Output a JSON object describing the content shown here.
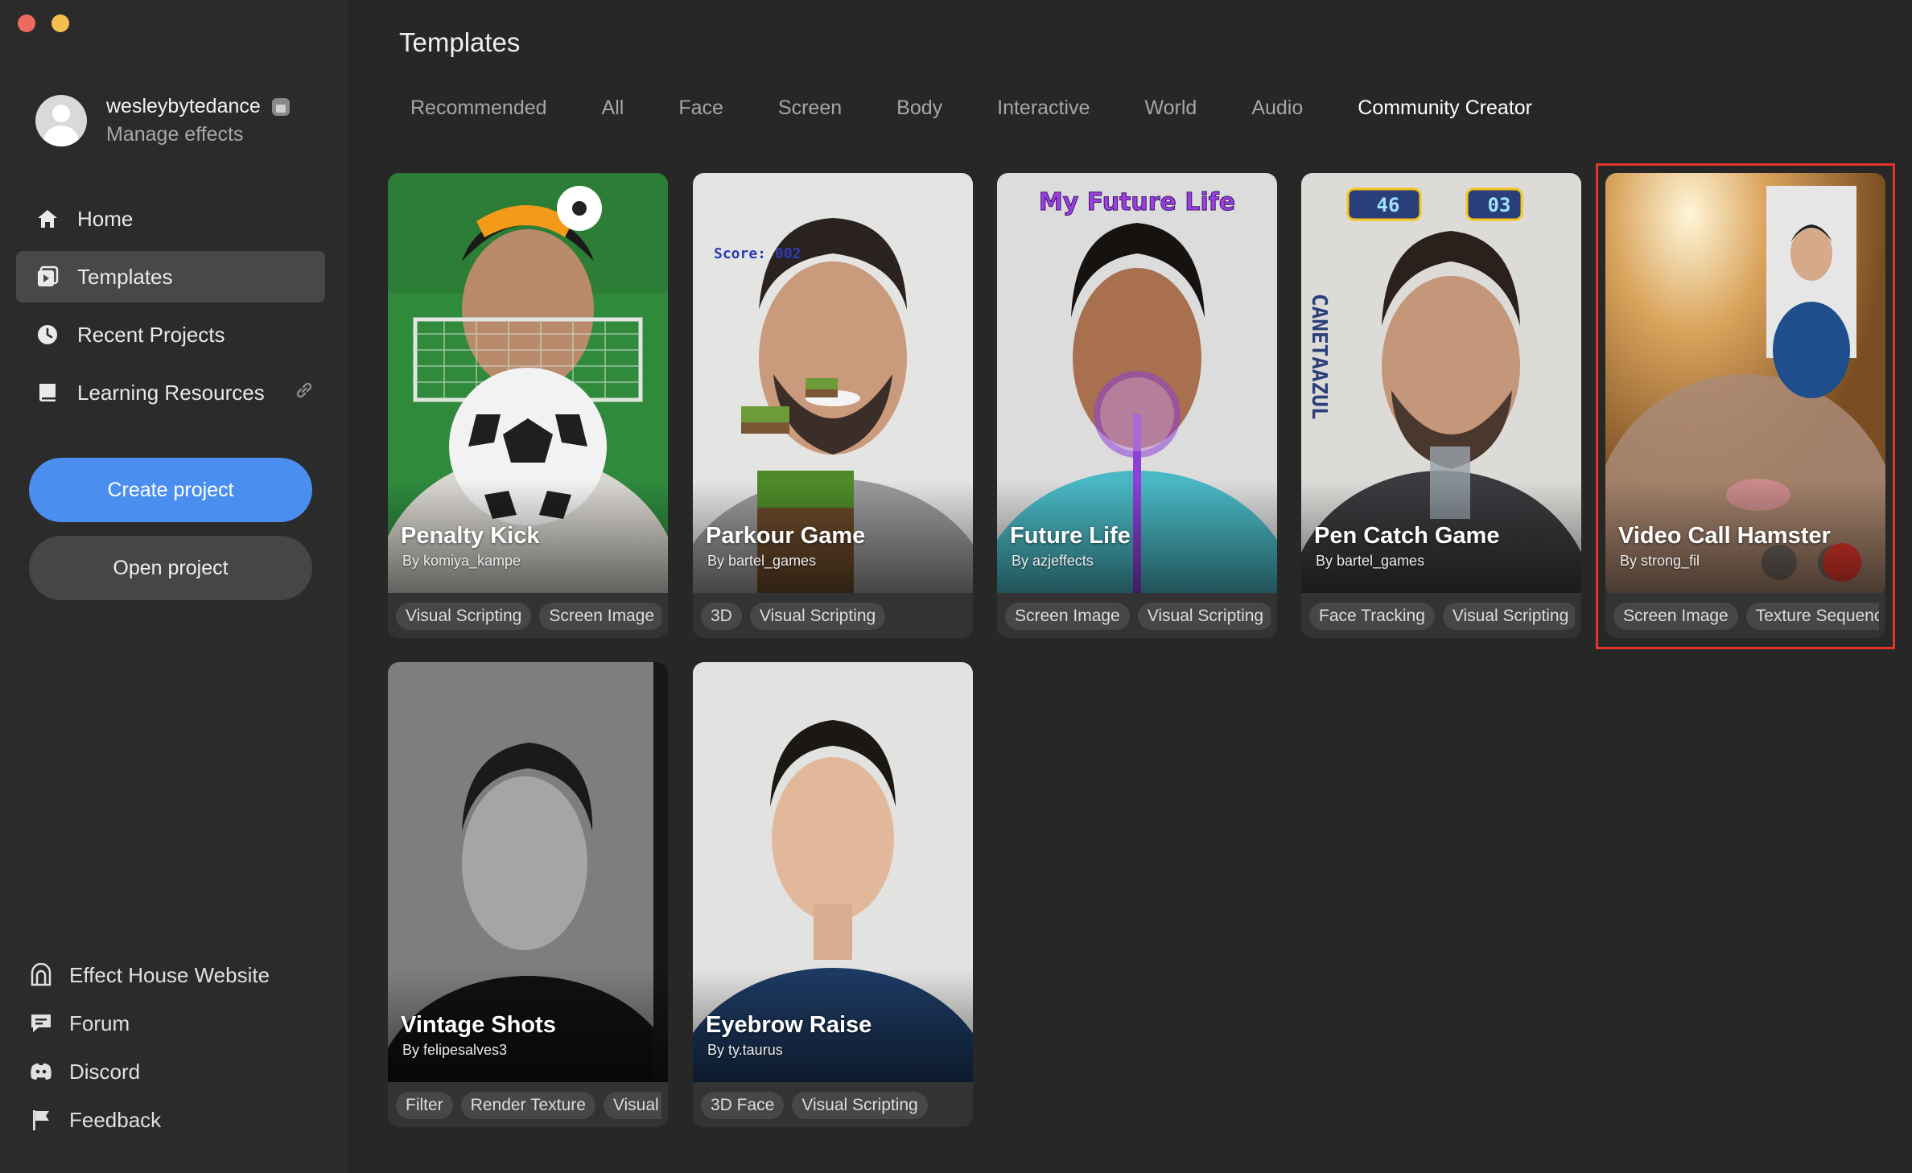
{
  "user": {
    "name": "wesleybytedance",
    "subtitle": "Manage effects"
  },
  "nav": [
    {
      "label": "Home",
      "icon": "home-icon"
    },
    {
      "label": "Templates",
      "icon": "templates-icon"
    },
    {
      "label": "Recent Projects",
      "icon": "clock-icon"
    },
    {
      "label": "Learning Resources",
      "icon": "book-icon"
    }
  ],
  "buttons": {
    "create": "Create project",
    "open": "Open project"
  },
  "bottom_nav": [
    {
      "label": "Effect House Website",
      "icon": "effect-house-icon"
    },
    {
      "label": "Forum",
      "icon": "forum-icon"
    },
    {
      "label": "Discord",
      "icon": "discord-icon"
    },
    {
      "label": "Feedback",
      "icon": "flag-icon"
    }
  ],
  "page_title": "Templates",
  "tabs": [
    "Recommended",
    "All",
    "Face",
    "Screen",
    "Body",
    "Interactive",
    "World",
    "Audio",
    "Community Creator"
  ],
  "active_tab": "Community Creator",
  "cards": [
    {
      "title": "Penalty Kick",
      "author": "By komiya_kampe",
      "tags": [
        "Visual Scripting",
        "Screen Image"
      ]
    },
    {
      "title": "Parkour Game",
      "author": "By bartel_games",
      "tags": [
        "3D",
        "Visual Scripting"
      ],
      "overlay": "Score: 002"
    },
    {
      "title": "Future Life",
      "author": "By azjeffects",
      "tags": [
        "Screen Image",
        "Visual Scripting"
      ],
      "overlay": "My Future Life"
    },
    {
      "title": "Pen Catch Game",
      "author": "By bartel_games",
      "tags": [
        "Face Tracking",
        "Visual Scripting"
      ],
      "overlay_timer": "46",
      "overlay_count": "03",
      "vertical_text": "CANETAAZUL"
    },
    {
      "title": "Video Call Hamster",
      "author": "By strong_fil",
      "tags": [
        "Screen Image",
        "Texture Sequence"
      ]
    },
    {
      "title": "Vintage Shots",
      "author": "By felipesalves3",
      "tags": [
        "Filter",
        "Render Texture",
        "Visual Scripting"
      ]
    },
    {
      "title": "Eyebrow Raise",
      "author": "By ty.taurus",
      "tags": [
        "3D Face",
        "Visual Scripting"
      ]
    }
  ],
  "colors": {
    "accent": "#4a8ef0",
    "highlight": "#e0362a",
    "background": "#272727"
  }
}
